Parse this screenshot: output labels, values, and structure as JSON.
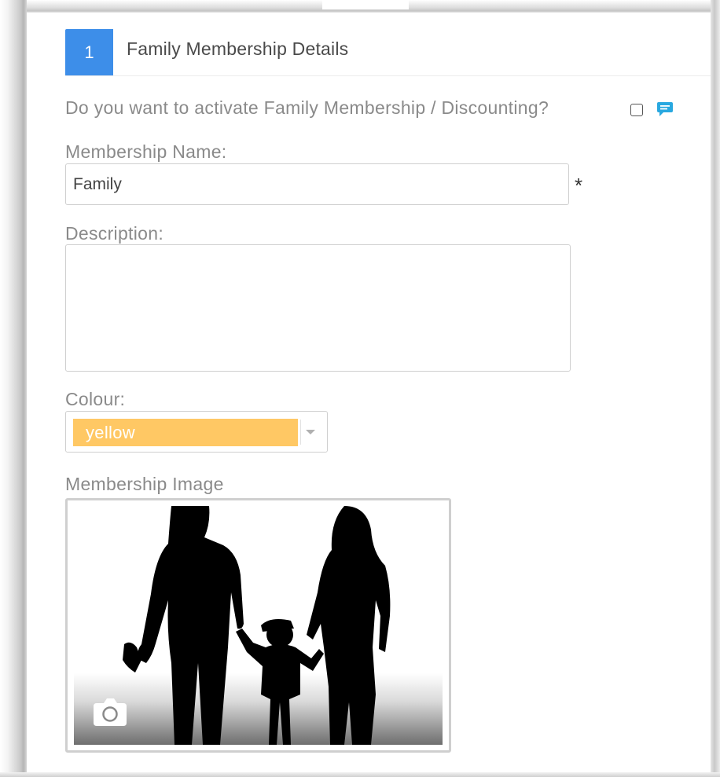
{
  "section": {
    "step_number": "1",
    "title": "Family Membership Details"
  },
  "family_toggle": {
    "question": "Do you want to activate Family Membership / Discounting?",
    "checked": false
  },
  "membership_name": {
    "label": "Membership Name:",
    "value": "Family",
    "required_marker": "*"
  },
  "description": {
    "label": "Description:",
    "value": ""
  },
  "colour": {
    "label": "Colour:",
    "selected": "yellow",
    "swatch_color": "#ffc864"
  },
  "membership_image": {
    "label": "Membership Image",
    "upload_icon": "camera-icon"
  },
  "colors": {
    "accent": "#3d8ee9",
    "comment_icon": "#29a8e0"
  }
}
